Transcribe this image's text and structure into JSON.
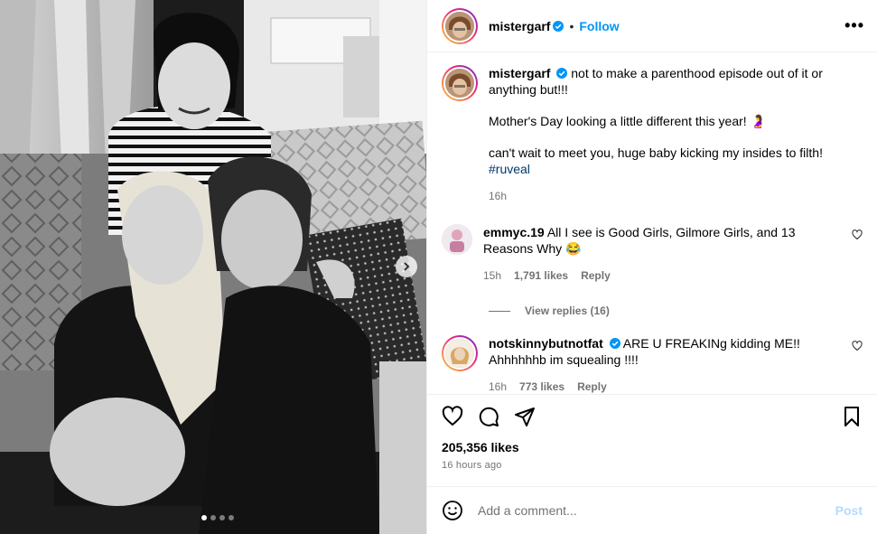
{
  "header": {
    "username": "mistergarf",
    "separator": "•",
    "follow_label": "Follow",
    "more_icon": "more-options-icon"
  },
  "caption": {
    "username": "mistergarf",
    "lines": [
      "not to make a parenthood episode out of it or anything but!!!",
      "Mother's Day looking a little different this year! 🤰",
      "can't wait to meet you, huge baby kicking my insides to filth!"
    ],
    "hashtag": "#ruveal",
    "time": "16h"
  },
  "comments": [
    {
      "username": "emmyc.19",
      "text": "All I see is Good Girls, Gilmore Girls, and 13 Reasons Why 😂",
      "time": "15h",
      "likes": "1,791 likes",
      "reply_label": "Reply",
      "view_replies": "View replies (16)"
    },
    {
      "username": "notskinnybutnotfat",
      "text": "ARE U FREAKINg kidding ME!! Ahhhhhhb im squealing !!!!",
      "time": "16h",
      "likes": "773 likes",
      "reply_label": "Reply"
    }
  ],
  "actions": {
    "likes": "205,356 likes",
    "posted": "16 hours ago"
  },
  "composer": {
    "placeholder": "Add a comment...",
    "post_label": "Post"
  },
  "carousel": {
    "slide": 1,
    "total": 4
  },
  "colors": {
    "link": "#0095f6",
    "hashtag": "#00376b",
    "muted": "#737373",
    "post_disabled": "#b3dbff"
  }
}
